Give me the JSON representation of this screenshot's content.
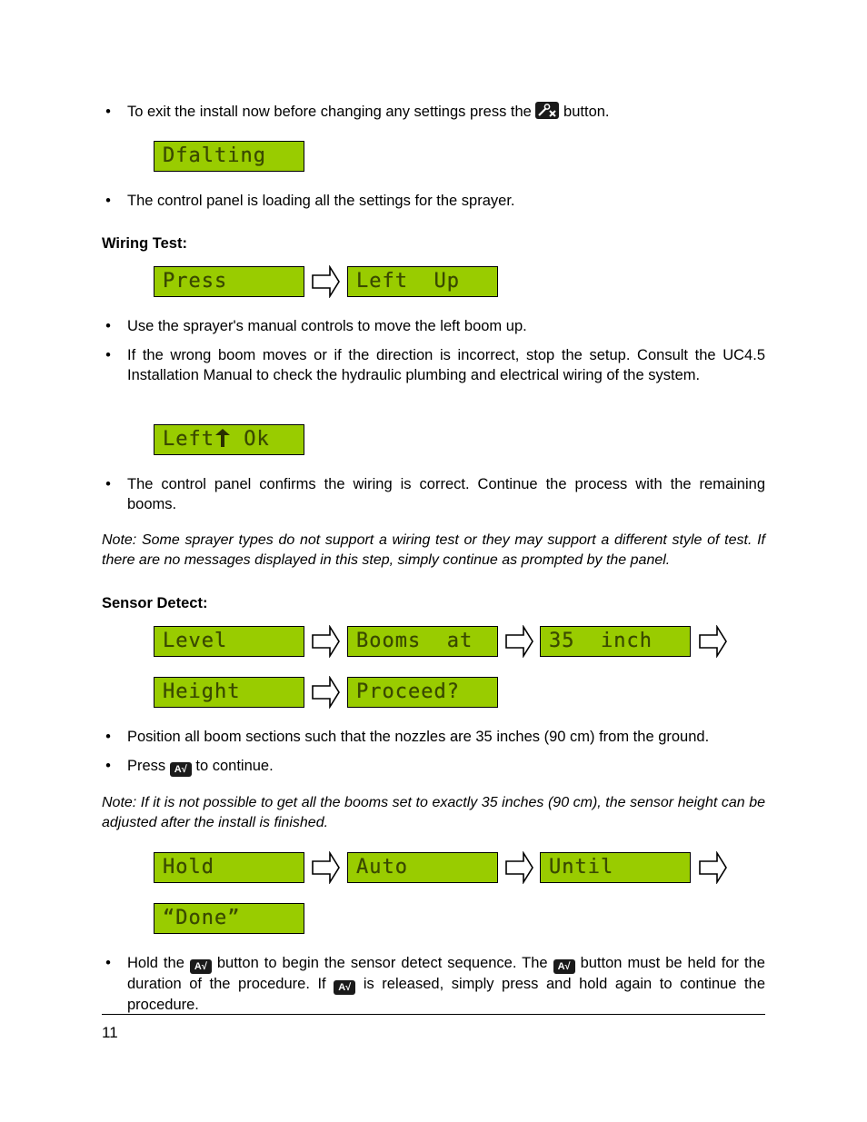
{
  "bullets": {
    "exit": {
      "before": "To exit the install now before changing any settings press the",
      "icon": "wrench-x-icon",
      "after": "button."
    },
    "loading": "The control panel is loading all the settings for the sprayer.",
    "manual_controls": "Use the sprayer's manual controls to move the left boom up.",
    "wrong_boom": "If the wrong boom moves or if the direction is incorrect, stop the setup.  Consult the UC4.5 Installation Manual to check the hydraulic plumbing and electrical wiring of the system.",
    "confirms": "The control panel confirms the wiring is correct.  Continue the process with the remaining booms.",
    "position": "Position all boom sections such that the nozzles are 35 inches (90 cm) from the ground.",
    "press": {
      "before": "Press",
      "icon_label": "A√",
      "after": "to continue."
    },
    "hold": {
      "p1": "Hold the",
      "p2": "button to begin the sensor detect sequence.  The",
      "p3": "button must be held for the duration of the procedure.  If",
      "p4": "is released, simply press and hold again to continue the procedure.",
      "icon_label": "A√"
    }
  },
  "headings": {
    "wiring_test": "Wiring Test:",
    "sensor_detect": "Sensor Detect:"
  },
  "notes": {
    "wiring": "Note: Some sprayer types do not support a wiring test or they may support a different style of test.  If there are no messages displayed in this step, simply continue as prompted by the panel.",
    "sensor": "Note: If it is not possible to get all the booms set to exactly 35 inches (90 cm), the sensor height can be adjusted after the install is finished."
  },
  "lcd": {
    "defaulting": "Dfalting",
    "press": "Press",
    "left_up": "Left  Up",
    "left_ok_left": "Left",
    "left_ok_right": " Ok",
    "level": "Level",
    "booms_at": "Booms  at",
    "inch": "35  inch",
    "height": "Height",
    "proceed": "Proceed?",
    "hold": "Hold",
    "auto": "Auto",
    "until": "Until",
    "done": "“Done”"
  },
  "colors": {
    "lcd_bg": "#99cc00",
    "lcd_text": "#3a4a00"
  },
  "footer": {
    "page_number": "11"
  }
}
